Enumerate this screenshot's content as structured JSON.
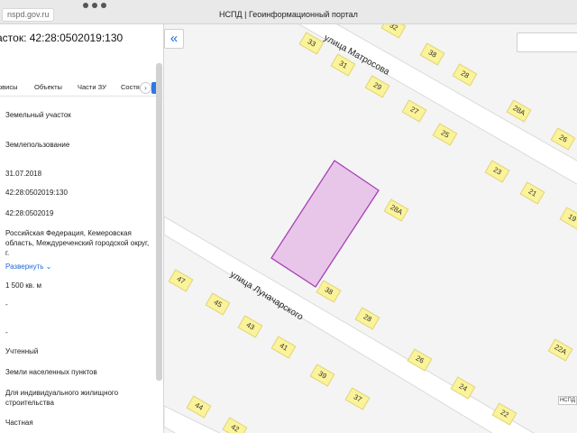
{
  "browser": {
    "url": "nspd.gov.ru",
    "title": "НСПД | Геоинформационный портал"
  },
  "sidebar": {
    "parcel_title": "астoк: 42:28:0502019:130",
    "tabs": [
      "рвисы",
      "Объекты",
      "Части ЗУ",
      "Состя"
    ],
    "fields": [
      "Земельный участок",
      "Землепользование",
      "31.07.2018",
      "42:28:0502019:130",
      "42:28:0502019",
      "Российская Федерация, Кемеровская область, Междуреченский городской округ, г.",
      "1 500 кв. м",
      "-",
      "-",
      "Учтенный",
      "Земли населенных пунктов",
      "Для индивидуального жилищного строительства",
      "Частная"
    ],
    "expand_label": "Развернуть"
  },
  "map": {
    "streets": [
      "улица Матросова",
      "улица Луначарского"
    ],
    "houses": [
      "33",
      "32",
      "38",
      "31",
      "28",
      "29",
      "27",
      "28А",
      "25",
      "26",
      "23",
      "21",
      "19",
      "28А",
      "47",
      "38",
      "45",
      "28",
      "43",
      "41",
      "26",
      "22А",
      "39",
      "24",
      "37",
      "22",
      "44",
      "42"
    ],
    "corner_tag": "НСПД",
    "parcel_color": "#e8c6ea",
    "parcel_border": "#a640b4"
  }
}
